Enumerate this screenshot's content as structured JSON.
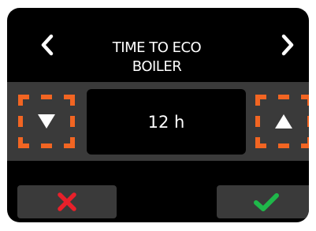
{
  "screen": {
    "title_line1": "TIME TO ECO",
    "title_line2": "BOILER",
    "value": "12 h"
  },
  "icons": {
    "prev": "chevron-left-icon",
    "next": "chevron-right-icon",
    "decrease": "triangle-down-icon",
    "increase": "triangle-up-icon",
    "cancel": "x-cross-icon",
    "confirm": "checkmark-icon"
  },
  "colors": {
    "background": "#000000",
    "panel": "#3a3a3a",
    "highlight": "#f26522",
    "cancel": "#e8202a",
    "confirm": "#1fb84a",
    "text": "#ffffff"
  }
}
